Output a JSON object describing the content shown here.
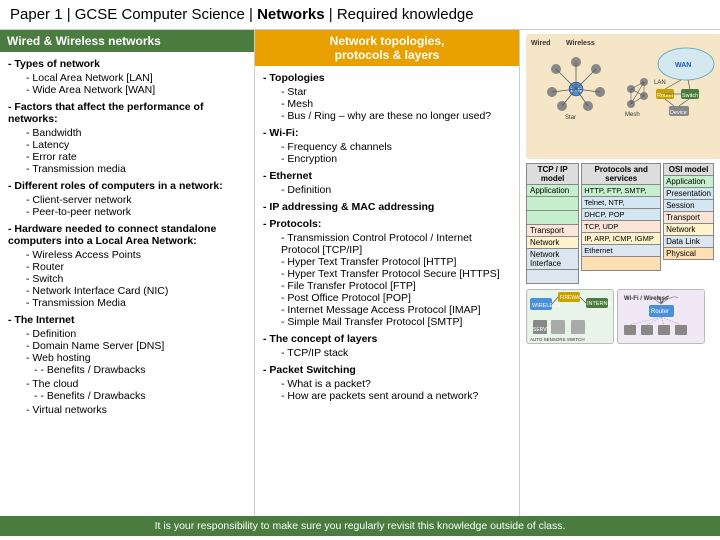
{
  "header": {
    "prefix": "Paper 1 | GCSE Computer Science | ",
    "highlight": "Networks",
    "suffix": " | Required knowledge"
  },
  "left": {
    "title": "Wired & Wireless networks",
    "sections": [
      {
        "heading": "- Types of network",
        "items": [
          "Local Area Network [LAN]",
          "Wide Area Network [WAN]"
        ]
      },
      {
        "heading": "- Factors that affect the performance of networks:",
        "items": [
          "Bandwidth",
          "Latency",
          "Error rate",
          "Transmission media"
        ]
      },
      {
        "heading": "- Different roles of computers in a network:",
        "items": [
          "Client-server network",
          "Peer-to-peer network"
        ]
      },
      {
        "heading": "- Hardware needed to connect standalone computers into a Local Area Network:",
        "items": [
          "Wireless Access Points",
          "Router",
          "Switch",
          "Network Interface Card (NIC)",
          "Transmission Media"
        ]
      },
      {
        "heading": "- The Internet",
        "items": [
          "Definition",
          "Domain Name Server [DNS]",
          "Web hosting",
          "Benefits / Drawbacks",
          "The cloud",
          "Benefits / Drawbacks",
          "Virtual networks"
        ],
        "subIndent": [
          3,
          3,
          4,
          5,
          4,
          5,
          3
        ]
      }
    ]
  },
  "middle": {
    "title1": "Network topologies,",
    "title2": "protocols & layers",
    "sections": [
      {
        "heading": "- Topologies",
        "items": [
          "Star",
          "Mesh",
          "Bus / Ring – why are these no longer used?"
        ]
      },
      {
        "heading": "- Wi-Fi:",
        "items": [
          "Frequency & channels",
          "Encryption"
        ]
      },
      {
        "heading": "- Ethernet",
        "items": [
          "Definition"
        ]
      },
      {
        "heading": "- IP addressing & MAC addressing"
      },
      {
        "heading": "- Protocols:",
        "items": [
          "Transmission Control Protocol / Internet Protocol [TCP/IP]",
          "Hyper Text Transfer Protocol [HTTP]",
          "Hyper Text Transfer Protocol Secure [HTTPS]",
          "File Transfer Protocol [FTP]",
          "Post Office Protocol [POP]",
          "Internet Message Access Protocol [IMAP]",
          "Simple Mail Transfer Protocol [SMTP]"
        ]
      },
      {
        "heading": "- The concept of layers",
        "items": [
          "TCP/IP stack"
        ]
      },
      {
        "heading": "- Packet Switching",
        "items": [
          "What is a packet?",
          "How are packets sent around a network?"
        ]
      }
    ]
  },
  "right": {
    "tcp_model_label": "TCP / IP model",
    "protocols_label": "Protocols and services",
    "osi_label": "OSI model",
    "tcp_layers": [
      {
        "tcp": "Application",
        "protocols": "HTTP, FTP, SMTP, DHCP, DNS, POP",
        "osi": "Application"
      },
      {
        "tcp": "",
        "protocols": "Telnet, NTP, DHCP, POP",
        "osi": "Presentation"
      },
      {
        "tcp": "",
        "protocols": "",
        "osi": "Session"
      },
      {
        "tcp": "Transport",
        "protocols": "TCP, UDP",
        "osi": "Transport"
      },
      {
        "tcp": "Network",
        "protocols": "IP, ARP, ICMP, IGMP",
        "osi": "Network"
      },
      {
        "tcp": "Network Interface",
        "protocols": "Ethernet",
        "osi": "Data Link"
      },
      {
        "tcp": "",
        "protocols": "",
        "osi": "Physical"
      }
    ]
  },
  "footer": {
    "text": "It is your responsibility to make sure you regularly revisit this knowledge outside of class."
  },
  "colors": {
    "left_header": "#4a7c3f",
    "middle_header": "#e8a000",
    "footer_bg": "#4a7c3f"
  }
}
